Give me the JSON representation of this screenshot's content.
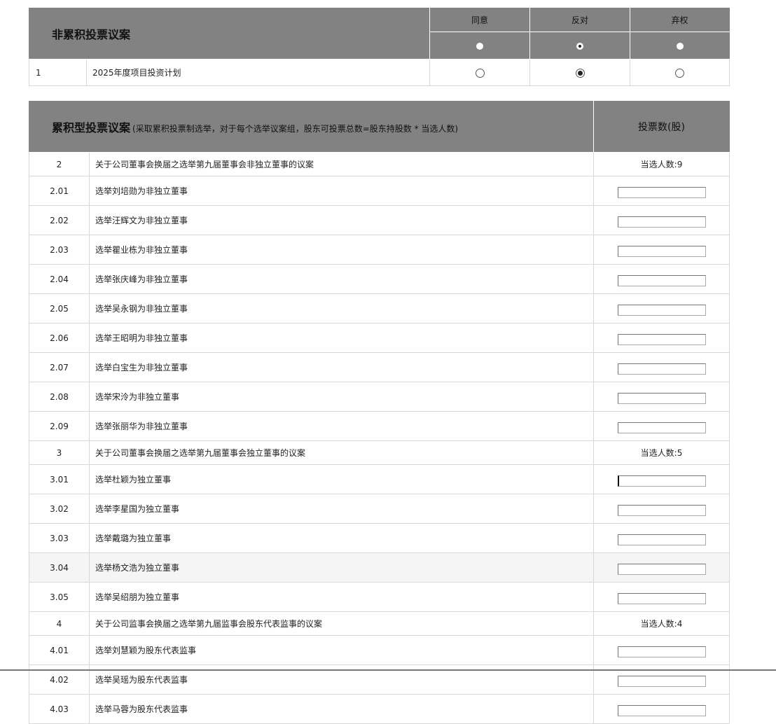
{
  "noncumulative": {
    "title": "非累积投票议案",
    "options": [
      {
        "label": "同意",
        "header_selected": false
      },
      {
        "label": "反对",
        "header_selected": true
      },
      {
        "label": "弃权",
        "header_selected": false
      }
    ],
    "rows": [
      {
        "num": "1",
        "title": "2025年度项目投资计划",
        "selected_option": "反对"
      }
    ]
  },
  "cumulative": {
    "title": "累积型投票议案",
    "note": "(采取累积投票制选举，对于每个选举议案组，股东可投票总数=股东持股数 * 当选人数)",
    "votes_header": "投票数(股)",
    "groups": [
      {
        "num": "2",
        "title": "关于公司董事会换届之选举第九届董事会非独立董事的议案",
        "elected_count": "当选人数:9",
        "items": [
          {
            "num": "2.01",
            "title": "选举刘培勋为非独立董事",
            "value": ""
          },
          {
            "num": "2.02",
            "title": "选举汪辉文为非独立董事",
            "value": ""
          },
          {
            "num": "2.03",
            "title": "选举瞿业栋为非独立董事",
            "value": ""
          },
          {
            "num": "2.04",
            "title": "选举张庆峰为非独立董事",
            "value": ""
          },
          {
            "num": "2.05",
            "title": "选举吴永钢为非独立董事",
            "value": ""
          },
          {
            "num": "2.06",
            "title": "选举王昭明为非独立董事",
            "value": ""
          },
          {
            "num": "2.07",
            "title": "选举白宝生为非独立董事",
            "value": ""
          },
          {
            "num": "2.08",
            "title": "选举宋泠为非独立董事",
            "value": ""
          },
          {
            "num": "2.09",
            "title": "选举张丽华为非独立董事",
            "value": ""
          }
        ]
      },
      {
        "num": "3",
        "title": "关于公司董事会换届之选举第九届董事会独立董事的议案",
        "elected_count": "当选人数:5",
        "items": [
          {
            "num": "3.01",
            "title": "选举杜颖为独立董事",
            "value": "",
            "focused": true
          },
          {
            "num": "3.02",
            "title": "选举李星国为独立董事",
            "value": ""
          },
          {
            "num": "3.03",
            "title": "选举戴璐为独立董事",
            "value": ""
          },
          {
            "num": "3.04",
            "title": "选举杨文浩为独立董事",
            "value": "",
            "hovered": true
          },
          {
            "num": "3.05",
            "title": "选举吴绍朋为独立董事",
            "value": ""
          }
        ]
      },
      {
        "num": "4",
        "title": "关于公司监事会换届之选举第九届监事会股东代表监事的议案",
        "elected_count": "当选人数:4",
        "items": [
          {
            "num": "4.01",
            "title": "选举刘慧颖为股东代表监事",
            "value": ""
          },
          {
            "num": "4.02",
            "title": "选举吴瑶为股东代表监事",
            "value": ""
          },
          {
            "num": "4.03",
            "title": "选举马蓉为股东代表监事",
            "value": ""
          }
        ]
      }
    ]
  }
}
